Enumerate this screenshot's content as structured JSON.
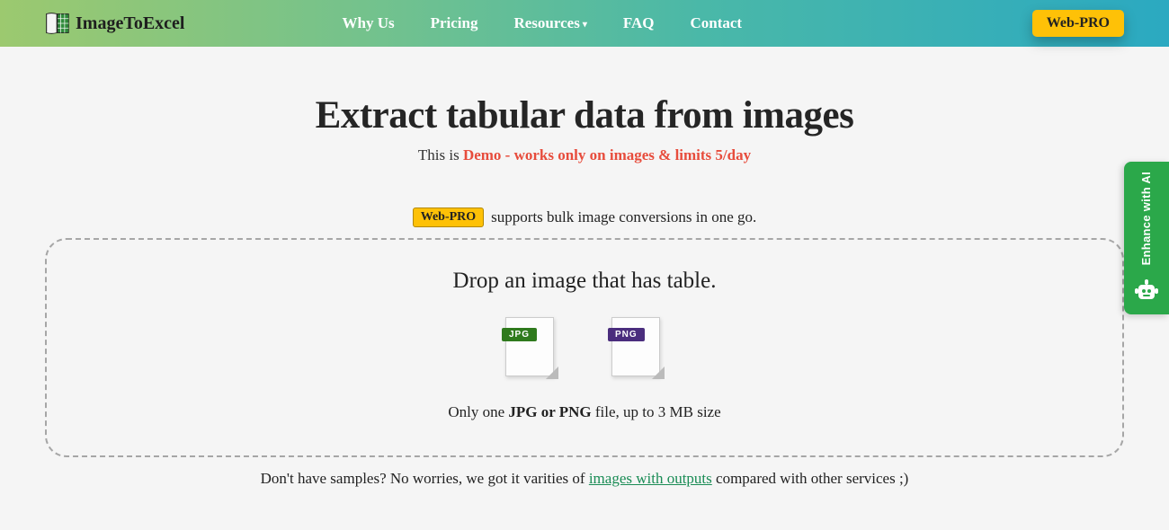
{
  "brand": "ImageToExcel",
  "nav": {
    "why": "Why Us",
    "pricing": "Pricing",
    "resources": "Resources",
    "faq": "FAQ",
    "contact": "Contact"
  },
  "webpro_btn": "Web-PRO",
  "hero": {
    "title": "Extract tabular data from images",
    "sub_prefix": "This is ",
    "sub_demo": "Demo - works only on images & limits 5/day"
  },
  "proline": {
    "badge": "Web-PRO",
    "text": "supports bulk image conversions in one go."
  },
  "drop": {
    "title": "Drop an image that has table.",
    "jpg": "JPG",
    "png": "PNG",
    "note_pre": "Only one ",
    "note_bold": "JPG or PNG",
    "note_post": " file, up to 3 MB size"
  },
  "samples": {
    "pre": "Don't have samples? No worries, we got it varities of ",
    "link": "images with outputs",
    "post": " compared with other services ;)"
  },
  "side": {
    "label": "Enhance\nwith AI"
  }
}
